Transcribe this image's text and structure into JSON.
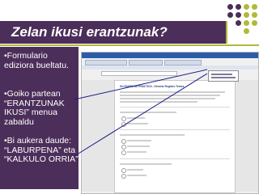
{
  "slide": {
    "title": "Zelan ikusi erantzunak?",
    "bullets": [
      "•Formulario ediziora bueltatu.",
      "•Goiko partean “ERANTZUNAK IKUSI” menua zabaldu",
      "•Bi aukera daude: “LABURPENA” eta “KALKULO ORRIA”"
    ]
  },
  "colors": {
    "title_band": "#4b2e59",
    "accent": "#b2b83a",
    "pointer": "#1c1c8c"
  },
  "screenshot": {
    "form_heading": "GLOSARIO DE PRÁCTICA - Generar Registro Textos"
  }
}
